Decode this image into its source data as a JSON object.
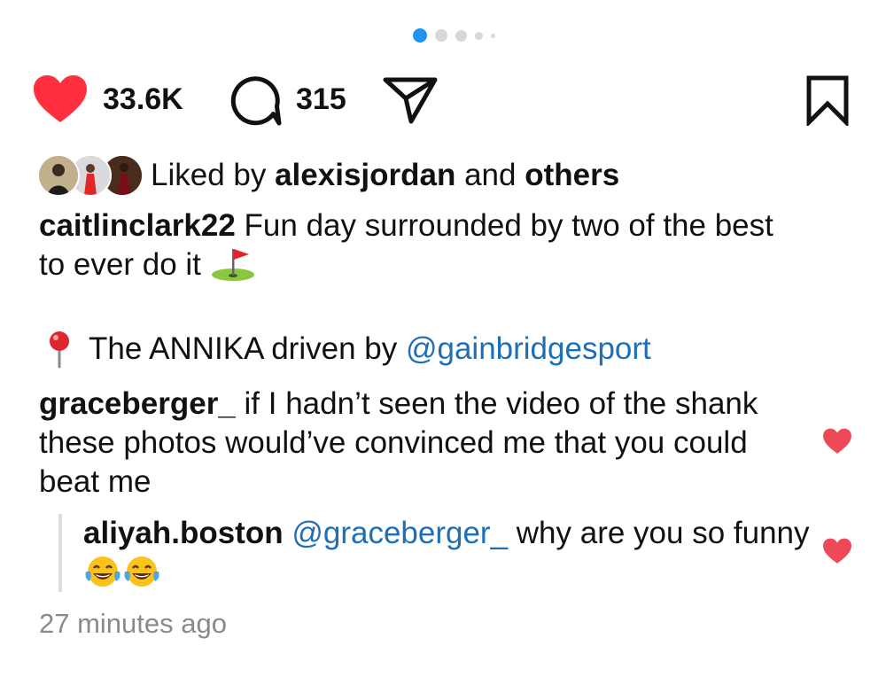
{
  "carousel": {
    "total_dots": 5,
    "active_index": 0
  },
  "actions": {
    "like_count": "33.6K",
    "comment_count": "315",
    "liked": true
  },
  "liked_by": {
    "prefix": "Liked by ",
    "user": "alexisjordan",
    "middle": " and ",
    "others": "others"
  },
  "caption": {
    "username": "caitlinclark22",
    "text": "Fun day surrounded by two of the best to ever do it"
  },
  "location": {
    "text": "The ANNIKA driven by ",
    "mention": "@gainbridgesport"
  },
  "comments": [
    {
      "username": "graceberger_",
      "text": "if I hadn’t seen the video of the shank these photos would’ve convinced me that you could beat me",
      "liked": true
    }
  ],
  "reply": {
    "username": "aliyah.boston",
    "mention": "@graceberger_",
    "text": "why are you so funny",
    "liked": true
  },
  "timestamp": "27 minutes ago",
  "icons": {
    "like": "heart-icon",
    "comment": "comment-bubble-icon",
    "share": "paper-plane-icon",
    "bookmark": "bookmark-icon",
    "location": "round-pushpin-icon",
    "caption_emoji": "flag-in-hole-icon",
    "reply_emoji": "tears-of-joy-icon"
  },
  "colors": {
    "heart": "#ff2f40",
    "mention": "#1f6fb5",
    "active_dot": "#1e94f2",
    "timestamp": "#8a8a8a",
    "comment_heart": "#ed4956"
  }
}
